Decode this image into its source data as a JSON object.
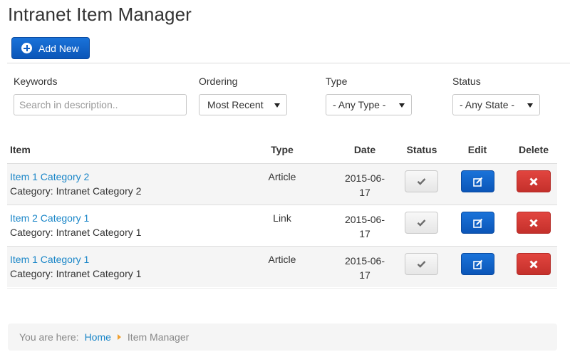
{
  "page": {
    "title": "Intranet Item Manager"
  },
  "toolbar": {
    "add_label": "Add New"
  },
  "filters": {
    "keywords_label": "Keywords",
    "keywords_placeholder": "Search in description..",
    "ordering_label": "Ordering",
    "ordering_value": "Most Recent",
    "type_label": "Type",
    "type_value": "- Any Type -",
    "status_label": "Status",
    "status_value": "- Any State -"
  },
  "table": {
    "headers": {
      "item": "Item",
      "type": "Type",
      "date": "Date",
      "status": "Status",
      "edit": "Edit",
      "delete": "Delete"
    },
    "rows": [
      {
        "title": "Item 1 Category 2",
        "category": "Category: Intranet Category 2",
        "type": "Article",
        "date_line1": "2015-06-",
        "date_line2": "17"
      },
      {
        "title": "Item 2 Category 1",
        "category": "Category: Intranet Category 1",
        "type": "Link",
        "date_line1": "2015-06-",
        "date_line2": "17"
      },
      {
        "title": "Item 1 Category 1",
        "category": "Category: Intranet Category 1",
        "type": "Article",
        "date_line1": "2015-06-",
        "date_line2": "17"
      }
    ]
  },
  "breadcrumb": {
    "prefix": "You are here:",
    "home": "Home",
    "current": "Item Manager"
  },
  "icons": {
    "add": "plus-circle-icon",
    "status": "check-icon",
    "edit": "edit-icon",
    "delete": "times-icon",
    "separator": "caret-right-icon"
  },
  "colors": {
    "primary": "#0e5ec4",
    "danger": "#d33a35",
    "link": "#1a86c8",
    "row_alt": "#f5f5f5"
  }
}
